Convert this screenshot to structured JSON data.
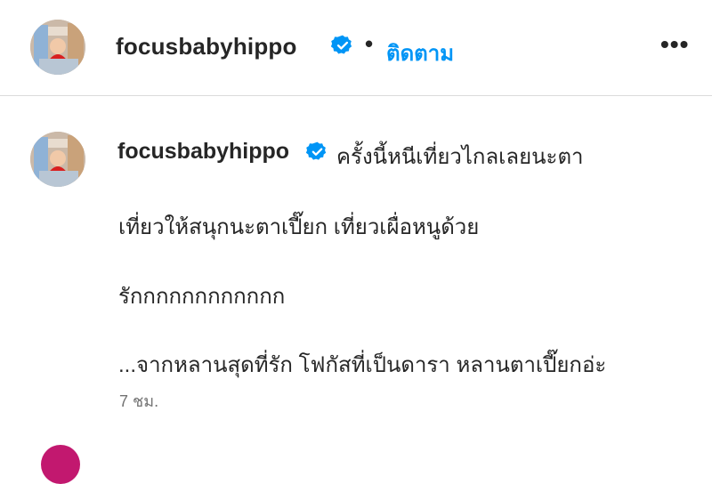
{
  "post_header": {
    "username": "focusbabyhippo",
    "separator": "•",
    "follow_label": "ติดตาม",
    "more_label": "•••"
  },
  "caption": {
    "username": "focusbabyhippo",
    "lines": [
      "ครั้งนี้หนีเที่ยวไกลเลยนะตา",
      "เที่ยวให้สนุกนะตาเปี๊ยก เที่ยวเผื่อหนูด้วย",
      "รักกกกกกกกกกกก",
      "...จากหลานสุดที่รัก โฟกัสที่เป็นดารา หลานตาเปี๊ยกอ่ะ"
    ],
    "timestamp": "7 ชม."
  },
  "icons": {
    "verified": "verified-badge-icon",
    "more": "more-options-icon"
  },
  "colors": {
    "verified_blue": "#0095f6",
    "follow_blue": "#0095f6",
    "text": "#262626",
    "muted": "#737373",
    "divider": "#dbdbdb"
  }
}
